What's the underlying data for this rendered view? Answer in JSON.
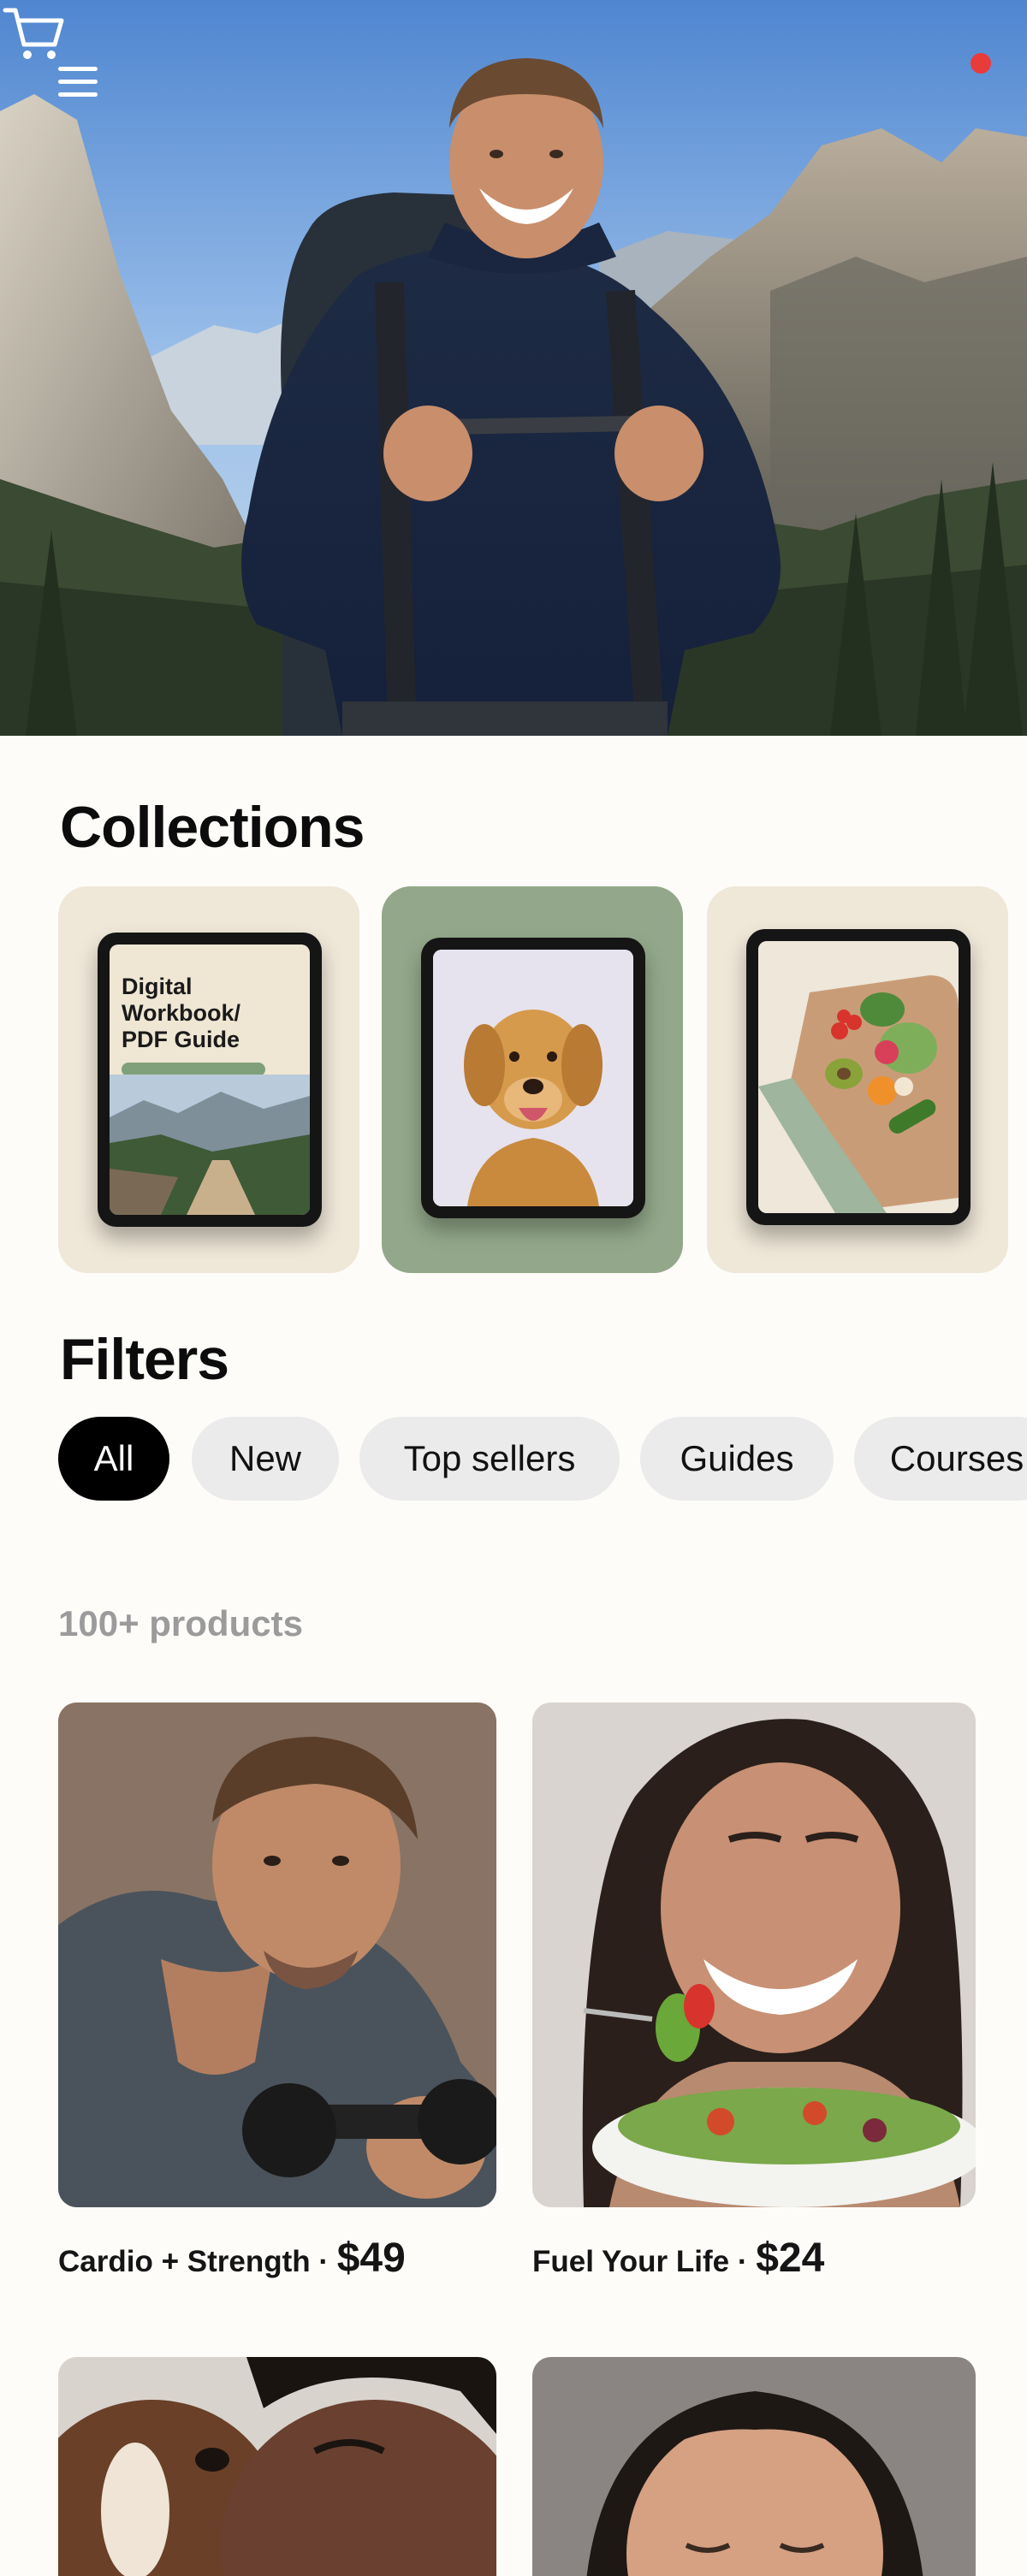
{
  "header": {
    "menu_icon": "hamburger-menu-icon",
    "cart_icon": "shopping-cart-icon",
    "cart_badge_color": "#ea3b3b"
  },
  "hero": {
    "image": "hiker-with-backpack-in-mountain-valley"
  },
  "collections": {
    "title": "Collections",
    "items": [
      {
        "image": "tablet-digital-workbook",
        "background": "#efe7d8",
        "screen_title": "Digital Workbook/ PDF Guide"
      },
      {
        "image": "tablet-golden-retriever",
        "background": "#93a88a"
      },
      {
        "image": "tablet-vegetables-cutting-board",
        "background": "#efe7d8"
      }
    ]
  },
  "filters": {
    "title": "Filters",
    "chips": [
      {
        "label": "All",
        "active": true
      },
      {
        "label": "New",
        "active": false
      },
      {
        "label": "Top sellers",
        "active": false
      },
      {
        "label": "Guides",
        "active": false
      },
      {
        "label": "Courses",
        "active": false
      }
    ]
  },
  "products": {
    "count_label": "100+ products",
    "items": [
      {
        "name": "Cardio + Strength",
        "sep": " · ",
        "price": "$49",
        "image": "man-lifting-dumbbell"
      },
      {
        "name": "Fuel Your Life",
        "sep": " · ",
        "price": "$24",
        "image": "woman-eating-salad"
      },
      {
        "image": "woman-with-dog"
      },
      {
        "image": "woman-eyes-closed"
      }
    ]
  }
}
